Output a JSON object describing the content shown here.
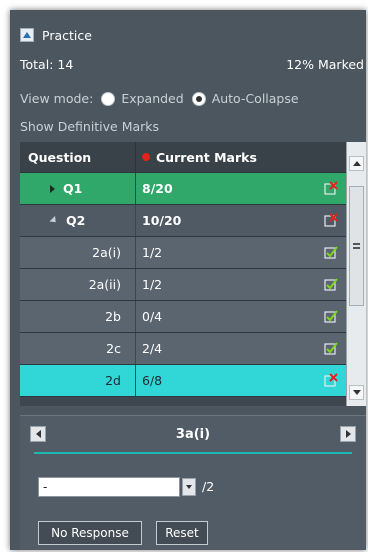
{
  "header": {
    "title": "Practice"
  },
  "summary": {
    "total": "Total: 14",
    "marked": "12% Marked"
  },
  "view_mode": {
    "label": "View mode:",
    "options": [
      "Expanded",
      "Auto-Collapse"
    ],
    "selected": "Auto-Collapse"
  },
  "definitive_marks_label": "Show Definitive Marks",
  "grid": {
    "columns": [
      "Question",
      "Current Marks"
    ],
    "rows": [
      {
        "question": "Q1",
        "marks": "8/20",
        "status": "incomplete",
        "level": "parent",
        "state": "selected-green"
      },
      {
        "question": "Q2",
        "marks": "10/20",
        "status": "incomplete",
        "level": "parent",
        "state": "expanded"
      },
      {
        "question": "2a(i)",
        "marks": "1/2",
        "status": "complete",
        "level": "child",
        "state": ""
      },
      {
        "question": "2a(ii)",
        "marks": "1/2",
        "status": "complete",
        "level": "child",
        "state": ""
      },
      {
        "question": "2b",
        "marks": "0/4",
        "status": "complete",
        "level": "child",
        "state": ""
      },
      {
        "question": "2c",
        "marks": "2/4",
        "status": "complete",
        "level": "child",
        "state": ""
      },
      {
        "question": "2d",
        "marks": "6/8",
        "status": "incomplete",
        "level": "child",
        "state": "selected-cyan"
      }
    ]
  },
  "marking": {
    "current_question": "3a(i)",
    "selected_mark": "-",
    "max_mark": "/2",
    "no_response_label": "No Response",
    "reset_label": "Reset"
  },
  "colors": {
    "panel": "#4b565f",
    "row_selected": "#2fa86a",
    "row_active": "#31d6d6",
    "accent_line": "#1ab8b0",
    "status_cross": "#e0241b",
    "status_tick": "#7ed321"
  }
}
